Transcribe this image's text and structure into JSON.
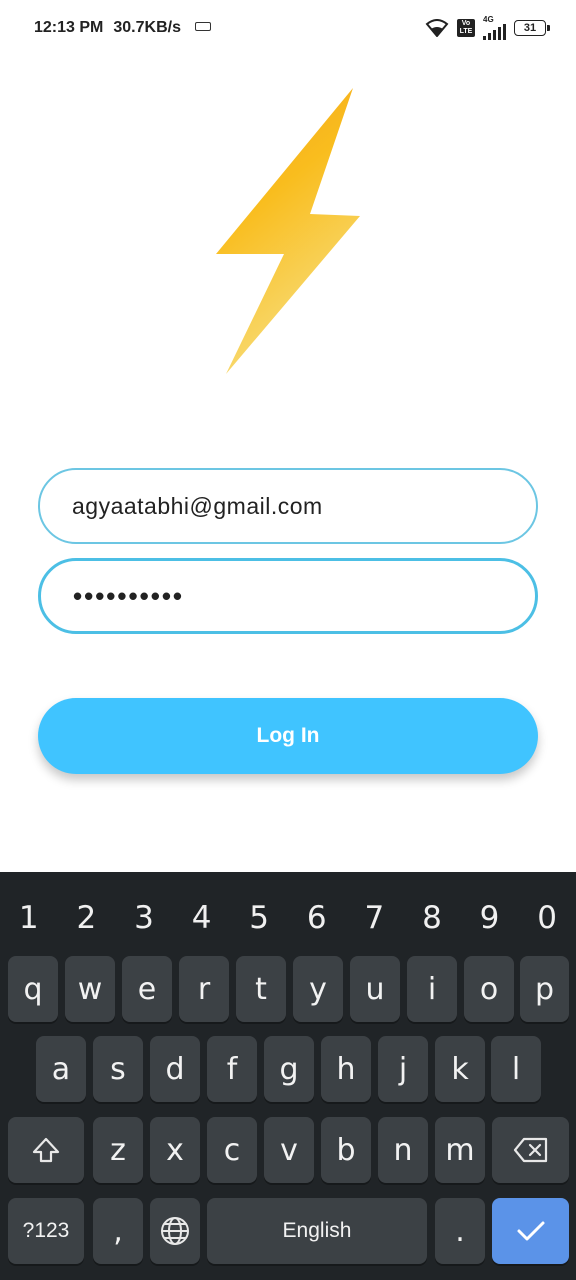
{
  "status_bar": {
    "time": "12:13 PM",
    "net_speed": "30.7KB/s",
    "battery": "31",
    "volte_label": "Vo LTE",
    "network_label": "4G"
  },
  "app": {
    "logo_icon": "lightning-bolt-icon",
    "email_value": "agyaatabhi@gmail.com",
    "password_value": "••••••••••",
    "login_label": "Log In",
    "accent_color": "#40c4ff"
  },
  "keyboard": {
    "numbers": [
      "1",
      "2",
      "3",
      "4",
      "5",
      "6",
      "7",
      "8",
      "9",
      "0"
    ],
    "row1": [
      "q",
      "w",
      "e",
      "r",
      "t",
      "y",
      "u",
      "i",
      "o",
      "p"
    ],
    "row2": [
      "a",
      "s",
      "d",
      "f",
      "g",
      "h",
      "j",
      "k",
      "l"
    ],
    "row3": [
      "z",
      "x",
      "c",
      "v",
      "b",
      "n",
      "m"
    ],
    "symbols_label": "?123",
    "comma_label": ",",
    "space_label": "English",
    "period_label": "."
  }
}
